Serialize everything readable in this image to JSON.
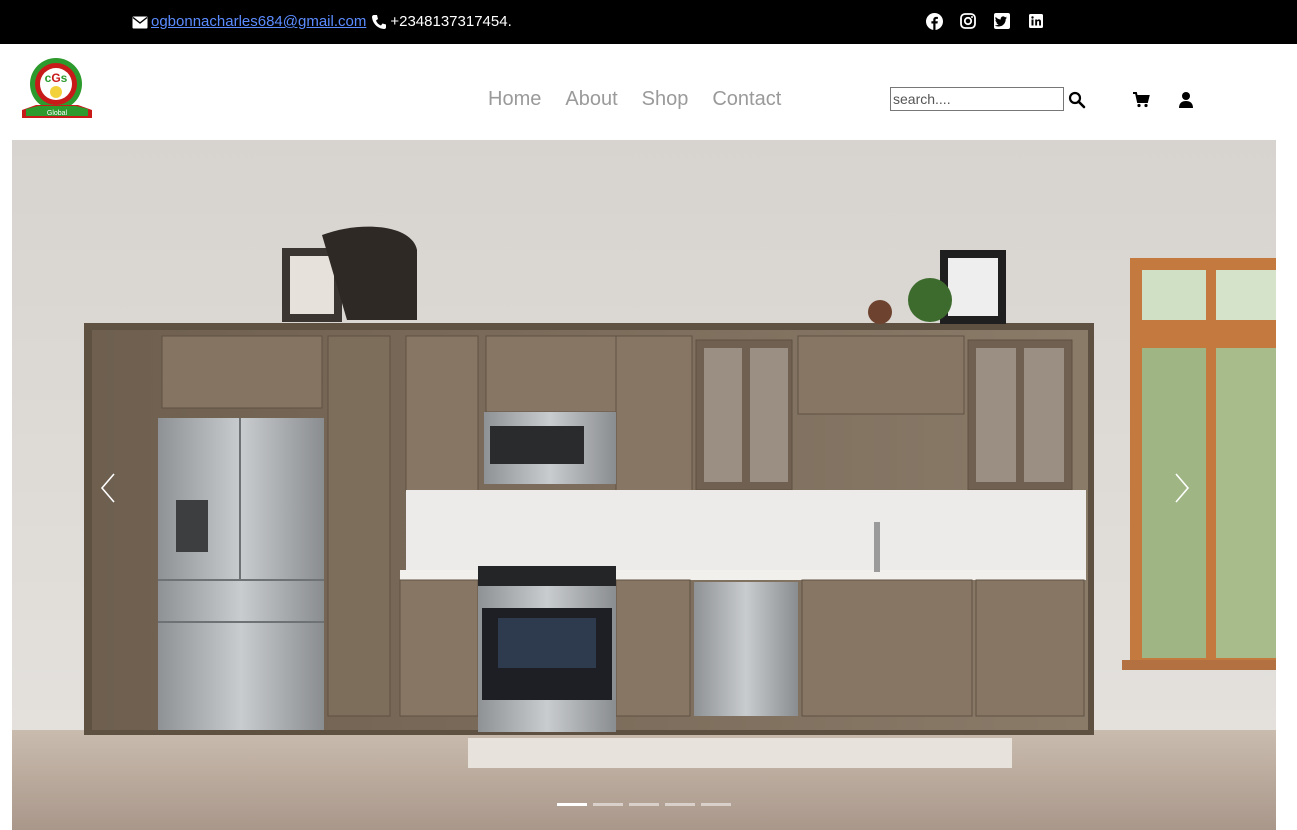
{
  "topbar": {
    "email": "ogbonnacharles684@gmail.com",
    "phone": "+2348137317454.",
    "social_icons": [
      "facebook-icon",
      "instagram-icon",
      "twitter-icon",
      "linkedin-icon"
    ]
  },
  "header": {
    "logo_text": "CGs",
    "logo_banner": "Global",
    "nav": [
      "Home",
      "About",
      "Shop",
      "Contact"
    ],
    "search_placeholder": "search....",
    "icons": [
      "search-icon",
      "cart-icon",
      "user-icon"
    ]
  },
  "hero": {
    "active_slide": 1,
    "slide_count": 5,
    "icons": [
      "chevron-left-icon",
      "chevron-right-icon"
    ]
  },
  "colors": {
    "topbar_bg": "#000000",
    "link": "#5b8cff",
    "nav_text": "#9a9a9a"
  }
}
